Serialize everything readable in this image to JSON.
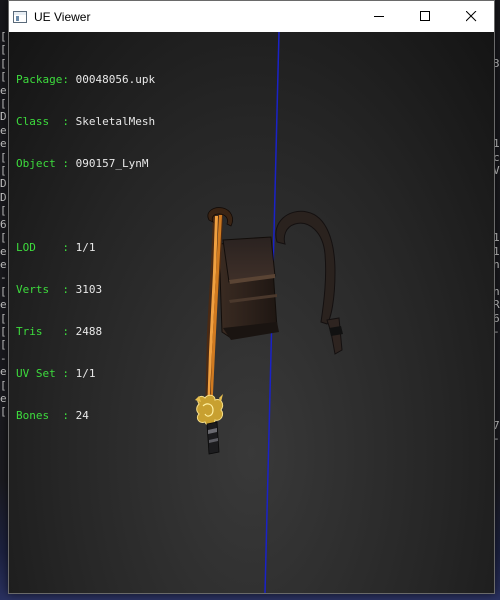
{
  "window": {
    "title": "UE Viewer"
  },
  "overlay": {
    "rows1": [
      {
        "label": "Package: ",
        "value": "00048056.upk"
      },
      {
        "label": "Class  : ",
        "value": "SkeletalMesh"
      },
      {
        "label": "Object : ",
        "value": "090157_LynM"
      }
    ],
    "rows2": [
      {
        "label": "LOD    : ",
        "value": "1/1"
      },
      {
        "label": "Verts  : ",
        "value": "3103"
      },
      {
        "label": "Tris   : ",
        "value": "2488"
      },
      {
        "label": "UV Set : ",
        "value": "1/1"
      },
      {
        "label": "Bones  : ",
        "value": "24"
      }
    ]
  },
  "background_console": {
    "left_chars": [
      "[",
      "[",
      "[",
      "[",
      "e",
      "[",
      "D",
      "e",
      "e",
      "[",
      "[",
      "D",
      "D",
      "[",
      "6",
      "[",
      "e",
      "e",
      "-",
      "[",
      "e",
      "[",
      "[",
      "[",
      "-",
      "e",
      "[",
      "e",
      "["
    ],
    "right_chars": [
      "",
      "",
      "3",
      "",
      "",
      "",
      "",
      "",
      "1",
      "c",
      "V",
      "",
      "",
      "",
      "",
      "1",
      "1",
      "n",
      "",
      "n",
      "R",
      "6",
      "-",
      "",
      "",
      "",
      "",
      "",
      "",
      "7",
      "-",
      ""
    ]
  },
  "colors": {
    "label_green": "#3ddc3d",
    "value_white": "#e8e8e8",
    "axis_blue": "#1a22c8"
  }
}
